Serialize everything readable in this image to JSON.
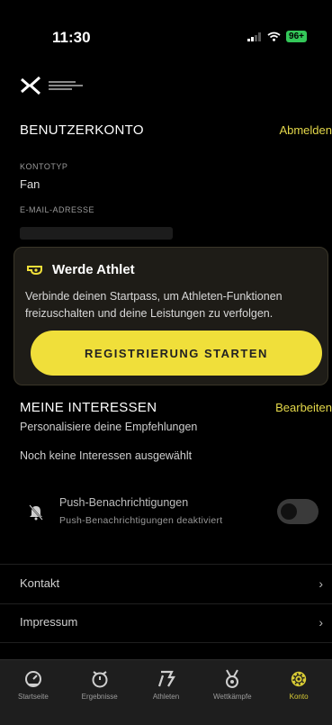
{
  "status_bar": {
    "time": "11:30",
    "battery": "96+"
  },
  "colors": {
    "accent": "#f0df3a",
    "background": "#000000",
    "card": "#1e1c17"
  },
  "account": {
    "title": "BENUTZERKONTO",
    "logout": "Abmelden",
    "type_label": "KONTOTYP",
    "type_value": "Fan",
    "email_label": "E-MAIL-ADRESSE"
  },
  "athlete_card": {
    "icon": "whistle-icon",
    "title": "Werde Athlet",
    "description": "Verbinde deinen Startpass, um Athleten-Funktionen freizuschalten und deine Leistungen zu verfolgen.",
    "button": "REGISTRIERUNG STARTEN"
  },
  "interests": {
    "title": "MEINE INTERESSEN",
    "edit": "Bearbeiten",
    "subtitle": "Personalisiere deine Empfehlungen",
    "empty": "Noch keine Interessen ausgewählt"
  },
  "push": {
    "icon": "bell-off-icon",
    "title": "Push-Benachrichtigungen",
    "subtitle": "Push-Benachrichtigungen deaktiviert",
    "enabled": false
  },
  "links": [
    {
      "label": "Kontakt"
    },
    {
      "label": "Impressum"
    }
  ],
  "tabs": [
    {
      "label": "Startseite",
      "icon": "speedometer-icon",
      "active": false
    },
    {
      "label": "Ergebnisse",
      "icon": "stopwatch-icon",
      "active": false
    },
    {
      "label": "Athleten",
      "icon": "athlete-icon",
      "active": false
    },
    {
      "label": "Wettkämpfe",
      "icon": "medal-icon",
      "active": false
    },
    {
      "label": "Konto",
      "icon": "gear-icon",
      "active": true
    }
  ]
}
